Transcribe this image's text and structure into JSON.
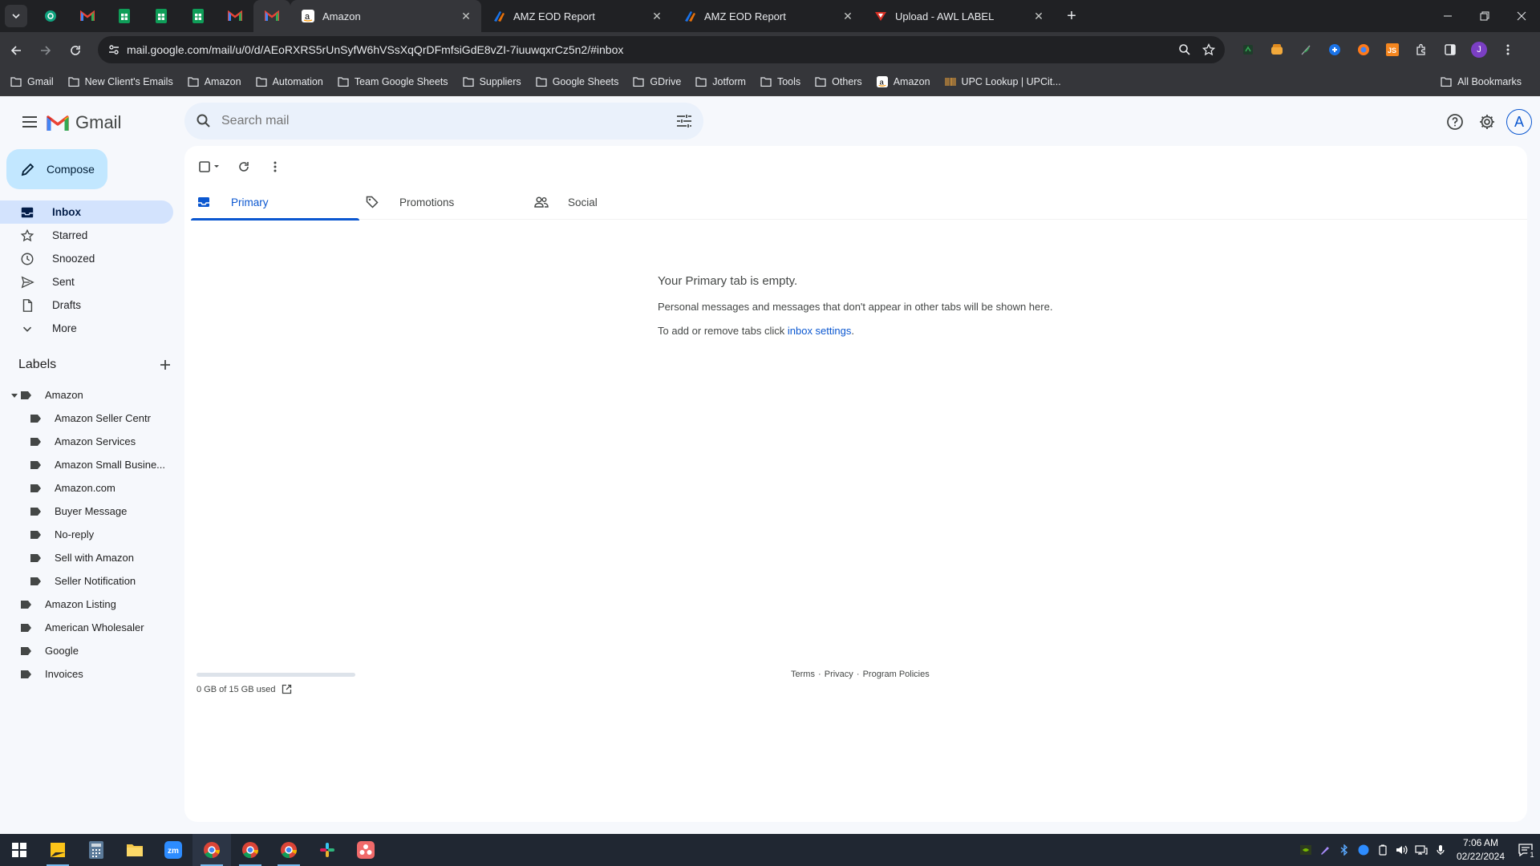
{
  "browser": {
    "tabs": [
      {
        "title": "Amazon",
        "active": true
      },
      {
        "title": "AMZ EOD Report",
        "active": false
      },
      {
        "title": "AMZ EOD Report",
        "active": false
      },
      {
        "title": "Upload - AWL LABEL",
        "active": false
      }
    ],
    "url": "mail.google.com/mail/u/0/d/AEoRXRS5rUnSyfW6hVSsXqQrDFmfsiGdE8vZI-7iuuwqxrCz5n2/#inbox",
    "profile_initial": "J",
    "bookmarks": [
      "Gmail",
      "New Client's Emails",
      "Amazon",
      "Automation",
      "Team Google Sheets",
      "Suppliers",
      "Google Sheets",
      "GDrive",
      "Jotform",
      "Tools",
      "Others",
      "Amazon",
      "UPC Lookup | UPCit..."
    ],
    "all_bookmarks": "All Bookmarks"
  },
  "gmail": {
    "logo_text": "Gmail",
    "search_placeholder": "Search mail",
    "account_initial": "A",
    "compose": "Compose",
    "nav": [
      {
        "label": "Inbox",
        "icon": "inbox-icon"
      },
      {
        "label": "Starred",
        "icon": "star-icon"
      },
      {
        "label": "Snoozed",
        "icon": "clock-icon"
      },
      {
        "label": "Sent",
        "icon": "send-icon"
      },
      {
        "label": "Drafts",
        "icon": "draft-icon"
      },
      {
        "label": "More",
        "icon": "chevron-down-icon"
      }
    ],
    "labels_heading": "Labels",
    "labels": [
      {
        "label": "Amazon",
        "level": 0,
        "expanded": true
      },
      {
        "label": "Amazon Seller Centr",
        "level": 1
      },
      {
        "label": "Amazon Services",
        "level": 1
      },
      {
        "label": "Amazon Small Busine...",
        "level": 1
      },
      {
        "label": "Amazon.com",
        "level": 1
      },
      {
        "label": "Buyer Message",
        "level": 1
      },
      {
        "label": "No-reply",
        "level": 1
      },
      {
        "label": "Sell with Amazon",
        "level": 1
      },
      {
        "label": "Seller Notification",
        "level": 1
      },
      {
        "label": "Amazon Listing",
        "level": 0
      },
      {
        "label": "American Wholesaler",
        "level": 0
      },
      {
        "label": "Google",
        "level": 0
      },
      {
        "label": "Invoices",
        "level": 0
      }
    ],
    "tabs": [
      "Primary",
      "Promotions",
      "Social"
    ],
    "empty": {
      "title": "Your Primary tab is empty.",
      "line1": "Personal messages and messages that don't appear in other tabs will be shown here.",
      "line2_prefix": "To add or remove tabs click ",
      "line2_link": "inbox settings",
      "line2_suffix": "."
    },
    "storage": "0 GB of 15 GB used",
    "footer": [
      "Terms",
      "Privacy",
      "Program Policies"
    ]
  },
  "taskbar": {
    "time": "7:06 AM",
    "date": "02/22/2024",
    "notification_count": "1"
  },
  "colors": {
    "accent": "#0b57d0",
    "inbox_active": "#d3e3fd",
    "compose": "#c2e7ff"
  }
}
